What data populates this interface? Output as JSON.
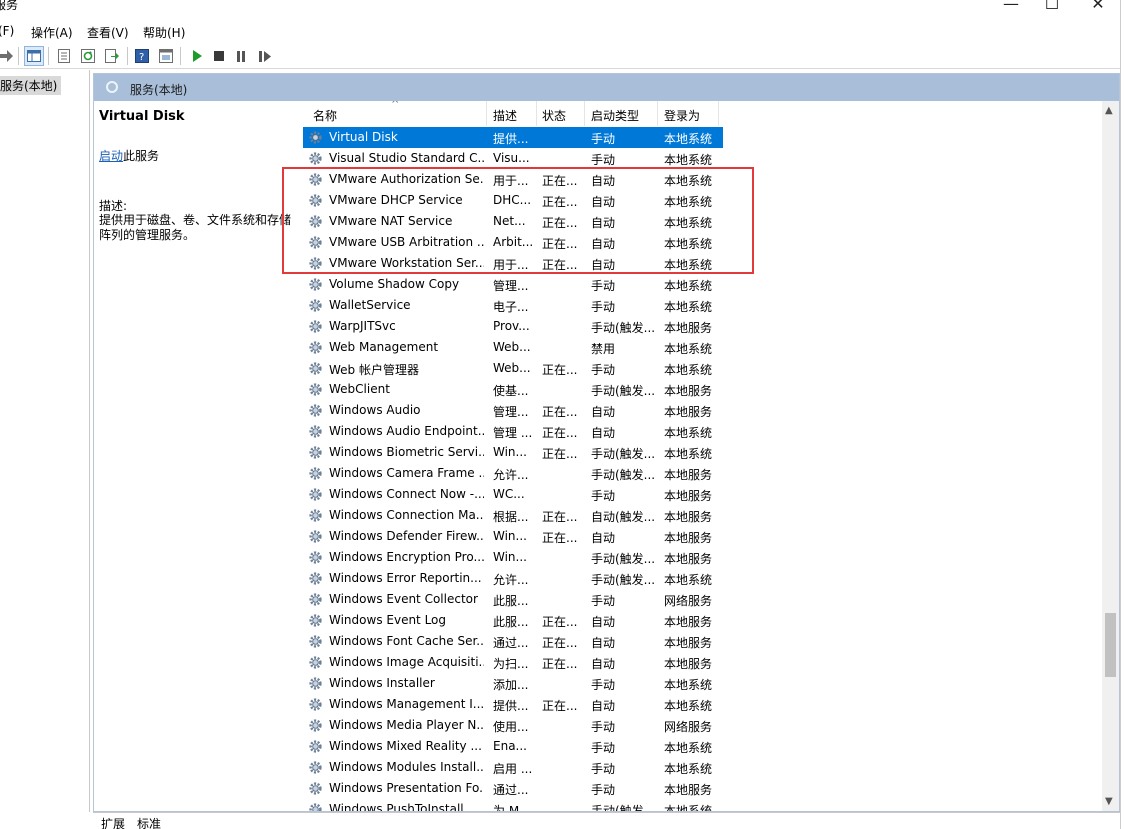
{
  "window": {
    "title": "服务",
    "controls": [
      "—",
      "☐",
      "✕"
    ]
  },
  "menu": [
    "(F)",
    "操作(A)",
    "查看(V)",
    "帮助(H)"
  ],
  "tree": {
    "node": "服务(本地)"
  },
  "pane_header": "服务(本地)",
  "extended": {
    "title": "Virtual Disk",
    "start_link": "启动",
    "start_suffix": "此服务",
    "desc_label": "描述:",
    "desc_line1": "提供用于磁盘、卷、文件系统和存储",
    "desc_line2": "阵列的管理服务。"
  },
  "columns": [
    "名称",
    "描述",
    "状态",
    "启动类型",
    "登录为"
  ],
  "rows": [
    {
      "name": "Virtual Disk",
      "desc": "提供...",
      "status": "",
      "startup": "手动",
      "logon": "本地系统",
      "selected": true
    },
    {
      "name": "Visual Studio Standard C...",
      "desc": "Visu...",
      "status": "",
      "startup": "手动",
      "logon": "本地系统"
    },
    {
      "name": "VMware Authorization Se...",
      "desc": "用于...",
      "status": "正在...",
      "startup": "自动",
      "logon": "本地系统"
    },
    {
      "name": "VMware DHCP Service",
      "desc": "DHC...",
      "status": "正在...",
      "startup": "自动",
      "logon": "本地系统"
    },
    {
      "name": "VMware NAT Service",
      "desc": "Net...",
      "status": "正在...",
      "startup": "自动",
      "logon": "本地系统"
    },
    {
      "name": "VMware USB Arbitration ...",
      "desc": "Arbit...",
      "status": "正在...",
      "startup": "自动",
      "logon": "本地系统"
    },
    {
      "name": "VMware Workstation Ser...",
      "desc": "用于...",
      "status": "正在...",
      "startup": "自动",
      "logon": "本地系统"
    },
    {
      "name": "Volume Shadow Copy",
      "desc": "管理...",
      "status": "",
      "startup": "手动",
      "logon": "本地系统"
    },
    {
      "name": "WalletService",
      "desc": "电子...",
      "status": "",
      "startup": "手动",
      "logon": "本地系统"
    },
    {
      "name": "WarpJITSvc",
      "desc": "Prov...",
      "status": "",
      "startup": "手动(触发...",
      "logon": "本地服务"
    },
    {
      "name": "Web Management",
      "desc": "Web...",
      "status": "",
      "startup": "禁用",
      "logon": "本地系统"
    },
    {
      "name": "Web 帐户管理器",
      "desc": "Web...",
      "status": "正在...",
      "startup": "手动",
      "logon": "本地系统"
    },
    {
      "name": "WebClient",
      "desc": "使基...",
      "status": "",
      "startup": "手动(触发...",
      "logon": "本地服务"
    },
    {
      "name": "Windows Audio",
      "desc": "管理...",
      "status": "正在...",
      "startup": "自动",
      "logon": "本地服务"
    },
    {
      "name": "Windows Audio Endpoint...",
      "desc": "管理 ...",
      "status": "正在...",
      "startup": "自动",
      "logon": "本地系统"
    },
    {
      "name": "Windows Biometric Servi...",
      "desc": "Win...",
      "status": "正在...",
      "startup": "手动(触发...",
      "logon": "本地系统"
    },
    {
      "name": "Windows Camera Frame ...",
      "desc": "允许...",
      "status": "",
      "startup": "手动(触发...",
      "logon": "本地服务"
    },
    {
      "name": "Windows Connect Now -...",
      "desc": "WC...",
      "status": "",
      "startup": "手动",
      "logon": "本地服务"
    },
    {
      "name": "Windows Connection Ma...",
      "desc": "根据...",
      "status": "正在...",
      "startup": "自动(触发...",
      "logon": "本地服务"
    },
    {
      "name": "Windows Defender Firew...",
      "desc": "Win...",
      "status": "正在...",
      "startup": "自动",
      "logon": "本地服务"
    },
    {
      "name": "Windows Encryption Pro...",
      "desc": "Win...",
      "status": "",
      "startup": "手动(触发...",
      "logon": "本地服务"
    },
    {
      "name": "Windows Error Reportin...",
      "desc": "允许...",
      "status": "",
      "startup": "手动(触发...",
      "logon": "本地系统"
    },
    {
      "name": "Windows Event Collector",
      "desc": "此服...",
      "status": "",
      "startup": "手动",
      "logon": "网络服务"
    },
    {
      "name": "Windows Event Log",
      "desc": "此服...",
      "status": "正在...",
      "startup": "自动",
      "logon": "本地服务"
    },
    {
      "name": "Windows Font Cache Ser...",
      "desc": "通过...",
      "status": "正在...",
      "startup": "自动",
      "logon": "本地服务"
    },
    {
      "name": "Windows Image Acquisiti...",
      "desc": "为扫...",
      "status": "正在...",
      "startup": "自动",
      "logon": "本地服务"
    },
    {
      "name": "Windows Installer",
      "desc": "添加...",
      "status": "",
      "startup": "手动",
      "logon": "本地系统"
    },
    {
      "name": "Windows Management I...",
      "desc": "提供...",
      "status": "正在...",
      "startup": "自动",
      "logon": "本地系统"
    },
    {
      "name": "Windows Media Player N...",
      "desc": "使用...",
      "status": "",
      "startup": "手动",
      "logon": "网络服务"
    },
    {
      "name": "Windows Mixed Reality ...",
      "desc": "Ena...",
      "status": "",
      "startup": "手动",
      "logon": "本地系统"
    },
    {
      "name": "Windows Modules Install...",
      "desc": "启用 ...",
      "status": "",
      "startup": "手动",
      "logon": "本地系统"
    },
    {
      "name": "Windows Presentation Fo...",
      "desc": "通过...",
      "status": "",
      "startup": "手动",
      "logon": "本地服务"
    },
    {
      "name": "Windows PushToInstall",
      "desc": "为 M...",
      "status": "",
      "startup": "手动(触发...",
      "logon": "本地系统"
    }
  ],
  "tabs": [
    "扩展",
    "标准"
  ],
  "colors": {
    "selected": "#0078d7",
    "highlight_box": "#e23a3a",
    "pane_header": "#a9bfd9"
  }
}
